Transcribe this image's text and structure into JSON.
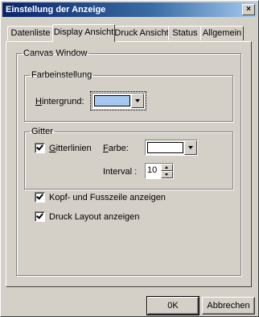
{
  "window": {
    "title": "Einstellung der Anzeige",
    "close_label": "×"
  },
  "tabs": [
    {
      "label": "Datenliste"
    },
    {
      "label": "Display Ansicht",
      "active": true
    },
    {
      "label": "Druck Ansicht"
    },
    {
      "label": "Status"
    },
    {
      "label": "Allgemein"
    }
  ],
  "canvas_window": {
    "legend": "Canvas Window",
    "farbeinstellung": {
      "legend": "Farbeinstellung",
      "hintergrund_label": "intergrund:",
      "hintergrund_mnemonic": "H",
      "hintergrund_color": "#a6c8f0"
    },
    "gitter": {
      "legend": "Gitter",
      "gitterlinien_label": "itterlinien",
      "gitterlinien_mnemonic": "G",
      "gitterlinien_checked": true,
      "farbe_label": "arbe:",
      "farbe_mnemonic": "F",
      "farbe_color": "#ffffff",
      "interval_label": "Interval :",
      "interval_value": "10"
    },
    "kopf_fusszeile_label": "Kopf- und Fusszeile anzeigen",
    "kopf_fusszeile_checked": true,
    "druck_layout_label": "Druck Layout anzeigen",
    "druck_layout_checked": true
  },
  "buttons": {
    "ok_label": "0K",
    "cancel_label": "Abbrechen"
  }
}
